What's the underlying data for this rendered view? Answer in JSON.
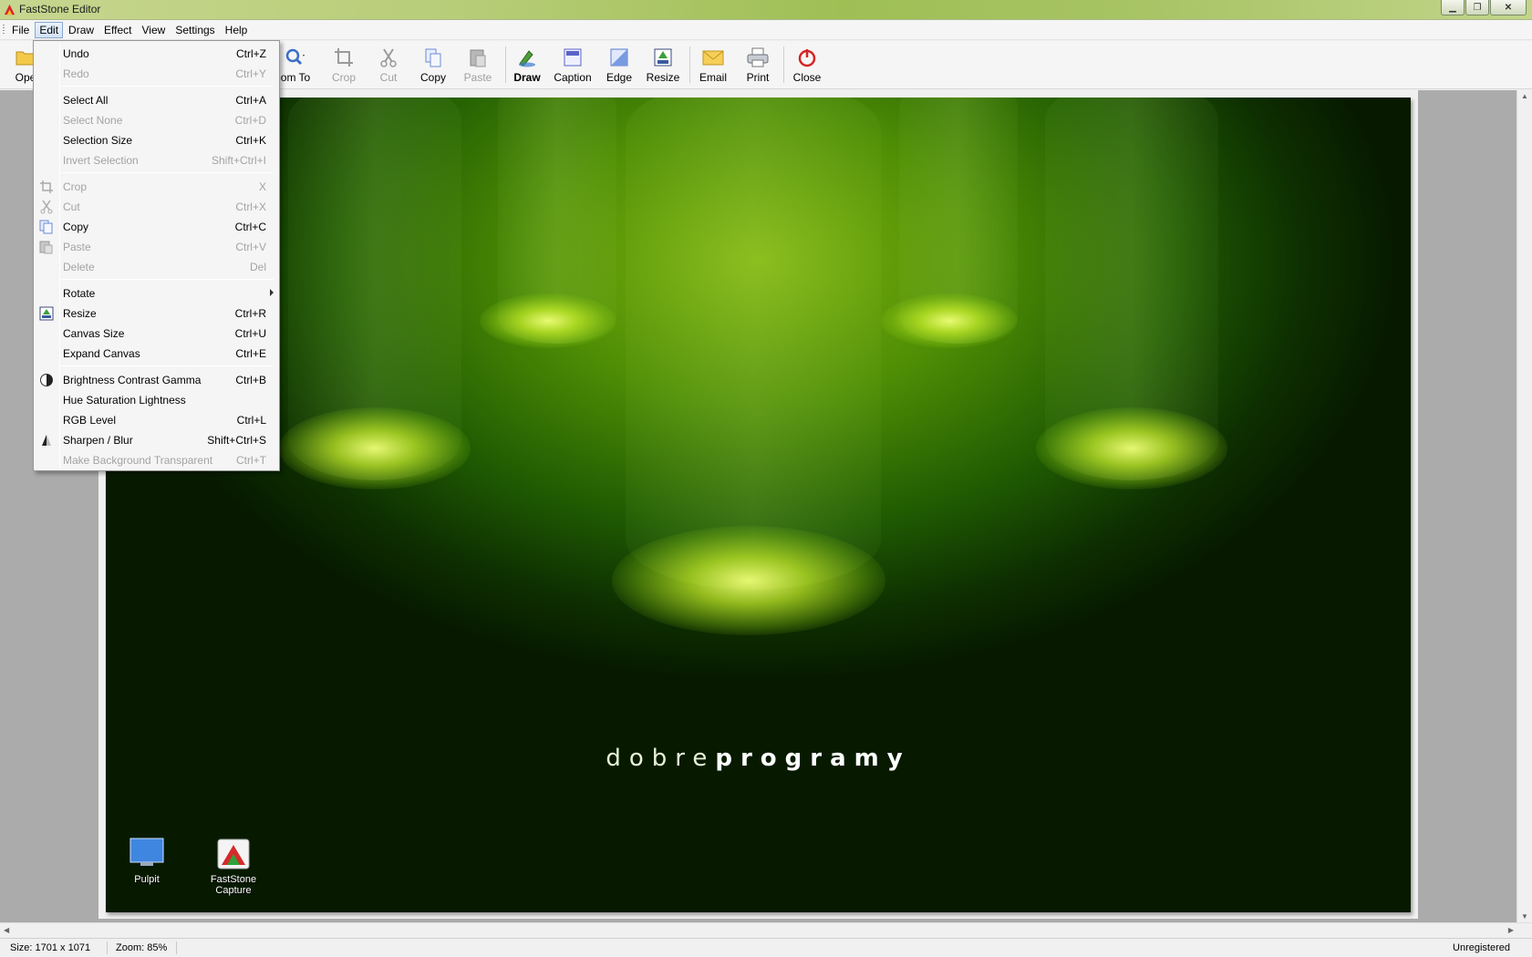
{
  "window": {
    "title": "FastStone Editor"
  },
  "menubar": {
    "items": [
      "File",
      "Edit",
      "Draw",
      "Effect",
      "View",
      "Settings",
      "Help"
    ]
  },
  "toolbar": {
    "open_label": "Ope",
    "zoomto_label": "om To",
    "buttons": [
      {
        "label": "Crop",
        "icon": "crop-icon",
        "enabled": false
      },
      {
        "label": "Cut",
        "icon": "scissors-icon",
        "enabled": false
      },
      {
        "label": "Copy",
        "icon": "copy-icon",
        "enabled": true
      },
      {
        "label": "Paste",
        "icon": "paste-icon",
        "enabled": false
      },
      {
        "label": "Draw",
        "icon": "draw-icon",
        "enabled": true
      },
      {
        "label": "Caption",
        "icon": "caption-icon",
        "enabled": true
      },
      {
        "label": "Edge",
        "icon": "edge-icon",
        "enabled": true
      },
      {
        "label": "Resize",
        "icon": "resize-icon",
        "enabled": true
      },
      {
        "label": "Email",
        "icon": "email-icon",
        "enabled": true
      },
      {
        "label": "Print",
        "icon": "printer-icon",
        "enabled": true
      },
      {
        "label": "Close",
        "icon": "power-icon",
        "enabled": true
      }
    ]
  },
  "edit_menu": {
    "items": [
      {
        "label": "Undo",
        "shortcut": "Ctrl+Z",
        "enabled": true
      },
      {
        "label": "Redo",
        "shortcut": "Ctrl+Y",
        "enabled": false
      },
      {
        "label": "Select All",
        "shortcut": "Ctrl+A",
        "enabled": true
      },
      {
        "label": "Select None",
        "shortcut": "Ctrl+D",
        "enabled": false
      },
      {
        "label": "Selection Size",
        "shortcut": "Ctrl+K",
        "enabled": true
      },
      {
        "label": "Invert Selection",
        "shortcut": "Shift+Ctrl+I",
        "enabled": false
      },
      {
        "label": "Crop",
        "shortcut": "X",
        "enabled": false,
        "icon": "crop-icon"
      },
      {
        "label": "Cut",
        "shortcut": "Ctrl+X",
        "enabled": false,
        "icon": "scissors-icon"
      },
      {
        "label": "Copy",
        "shortcut": "Ctrl+C",
        "enabled": true,
        "icon": "copy-icon"
      },
      {
        "label": "Paste",
        "shortcut": "Ctrl+V",
        "enabled": false,
        "icon": "paste-icon"
      },
      {
        "label": "Delete",
        "shortcut": "Del",
        "enabled": false
      },
      {
        "label": "Rotate",
        "shortcut": "",
        "enabled": true,
        "submenu": true
      },
      {
        "label": "Resize",
        "shortcut": "Ctrl+R",
        "enabled": true,
        "icon": "resize-icon"
      },
      {
        "label": "Canvas Size",
        "shortcut": "Ctrl+U",
        "enabled": true
      },
      {
        "label": "Expand Canvas",
        "shortcut": "Ctrl+E",
        "enabled": true
      },
      {
        "label": "Brightness Contrast Gamma",
        "shortcut": "Ctrl+B",
        "enabled": true,
        "icon": "contrast-icon"
      },
      {
        "label": "Hue Saturation Lightness",
        "shortcut": "",
        "enabled": true
      },
      {
        "label": "RGB Level",
        "shortcut": "Ctrl+L",
        "enabled": true
      },
      {
        "label": "Sharpen / Blur",
        "shortcut": "Shift+Ctrl+S",
        "enabled": true,
        "icon": "sharpen-icon"
      },
      {
        "label": "Make Background Transparent",
        "shortcut": "Ctrl+T",
        "enabled": false
      }
    ]
  },
  "image": {
    "brand_light": "dobre",
    "brand_bold": "programy",
    "desktop_icons": [
      {
        "label": "Pulpit",
        "icon": "monitor-icon"
      },
      {
        "label": "FastStone Capture",
        "icon": "faststone-capture-icon"
      }
    ]
  },
  "status": {
    "size": "Size: 1701 x 1071",
    "zoom": "Zoom: 85%",
    "registration": "Unregistered"
  },
  "colors": {
    "menu_highlight": "#d2e3f7",
    "image_green": "#4d8c05"
  }
}
